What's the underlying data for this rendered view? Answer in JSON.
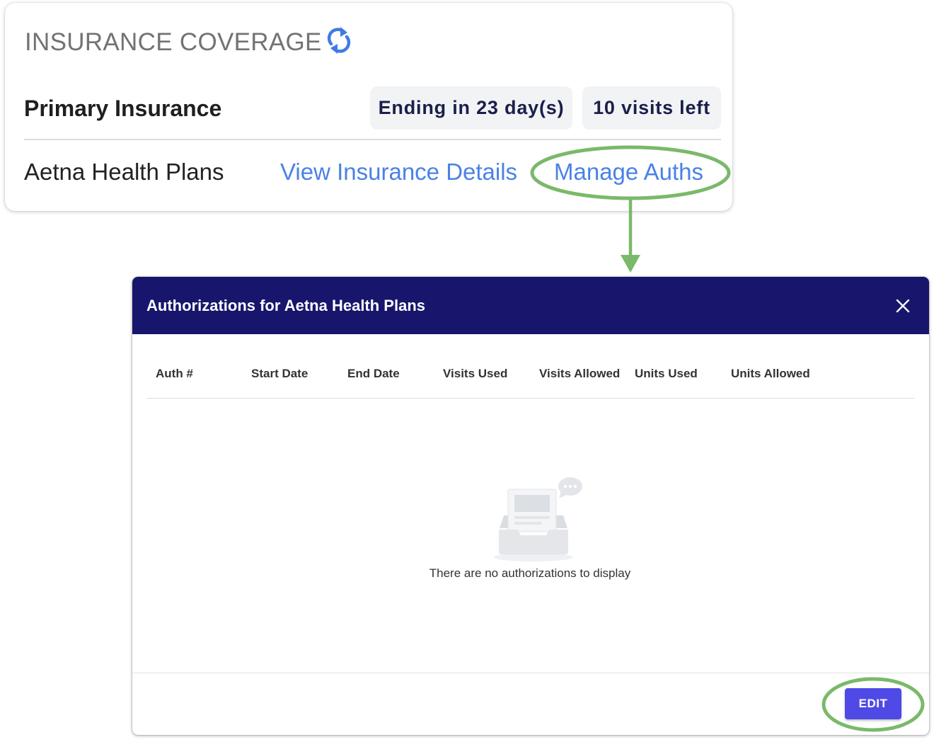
{
  "insurance_card": {
    "title": "INSURANCE COVERAGE",
    "refresh_icon": "sync-icon",
    "primary_label": "Primary Insurance",
    "chips": {
      "ending": "Ending in 23 day(s)",
      "visits_left": "10 visits left"
    },
    "plan_name": "Aetna Health Plans",
    "links": {
      "view_details": "View Insurance Details",
      "manage_auths": "Manage Auths"
    },
    "accent_color": "#4a82e6"
  },
  "dialog": {
    "title": "Authorizations for Aetna Health Plans",
    "close_icon": "close-icon",
    "header_color": "#17166c",
    "columns": [
      "Auth #",
      "Start Date",
      "End Date",
      "Visits Used",
      "Visits Allowed",
      "Units Used",
      "Units Allowed"
    ],
    "rows": [],
    "empty_message": "There are no authorizations to display",
    "empty_icon": "empty-inbox-icon",
    "edit_label": "EDIT",
    "button_color": "#4f4ae6"
  },
  "annotations": {
    "highlight_color": "#7ab96a"
  }
}
